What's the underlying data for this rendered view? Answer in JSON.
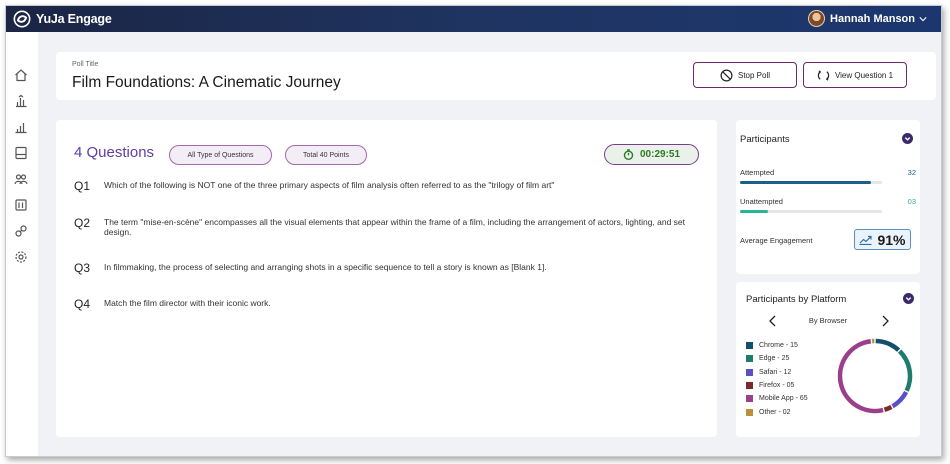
{
  "app": {
    "name": "YuJa Engage"
  },
  "user": {
    "name": "Hannah Manson"
  },
  "poll": {
    "label": "Poll Title",
    "title": "Film Foundations: A Cinematic Journey",
    "stop_label": "Stop Poll",
    "view_label": "View Question 1"
  },
  "questions": {
    "count_label": "4 Questions",
    "type_filter": "All Type of Questions",
    "points": "Total 40 Points",
    "timer": "00:29:51",
    "items": [
      {
        "num": "Q1",
        "text": "Which of the following is NOT one of the three primary aspects of film analysis often referred to as the \"trilogy of film art\""
      },
      {
        "num": "Q2",
        "text": "The term \"mise-en-scène\" encompasses all the visual elements that appear within the frame of a film, including the arrangement of actors, lighting, and set design."
      },
      {
        "num": "Q3",
        "text": "In filmmaking, the process of selecting and arranging shots in a specific sequence to tell a story is known as [Blank 1]."
      },
      {
        "num": "Q4",
        "text": "Match the film director with their iconic work."
      }
    ]
  },
  "participants": {
    "title": "Participants",
    "attempted": {
      "label": "Attempted",
      "value": "32",
      "fraction": 0.92,
      "color": "#1b5f8c"
    },
    "unattempted": {
      "label": "Unattempted",
      "value": "03",
      "fraction": 0.2,
      "color": "#2bb39a"
    },
    "engagement": {
      "label": "Average Engagement",
      "value": "91%"
    }
  },
  "platform": {
    "title": "Participants by Platform",
    "view": "By Browser",
    "items": [
      {
        "label": "Chrome - 15",
        "count": 15,
        "color": "#14506e"
      },
      {
        "label": "Edge - 25",
        "count": 25,
        "color": "#1d7c6e"
      },
      {
        "label": "Safari - 12",
        "count": 12,
        "color": "#5a4fc4"
      },
      {
        "label": "Firefox - 05",
        "count": 5,
        "color": "#7a2a2a"
      },
      {
        "label": "Mobile App - 65",
        "count": 65,
        "color": "#9b3f8c"
      },
      {
        "label": "Other - 02",
        "count": 2,
        "color": "#b8913a"
      }
    ]
  }
}
